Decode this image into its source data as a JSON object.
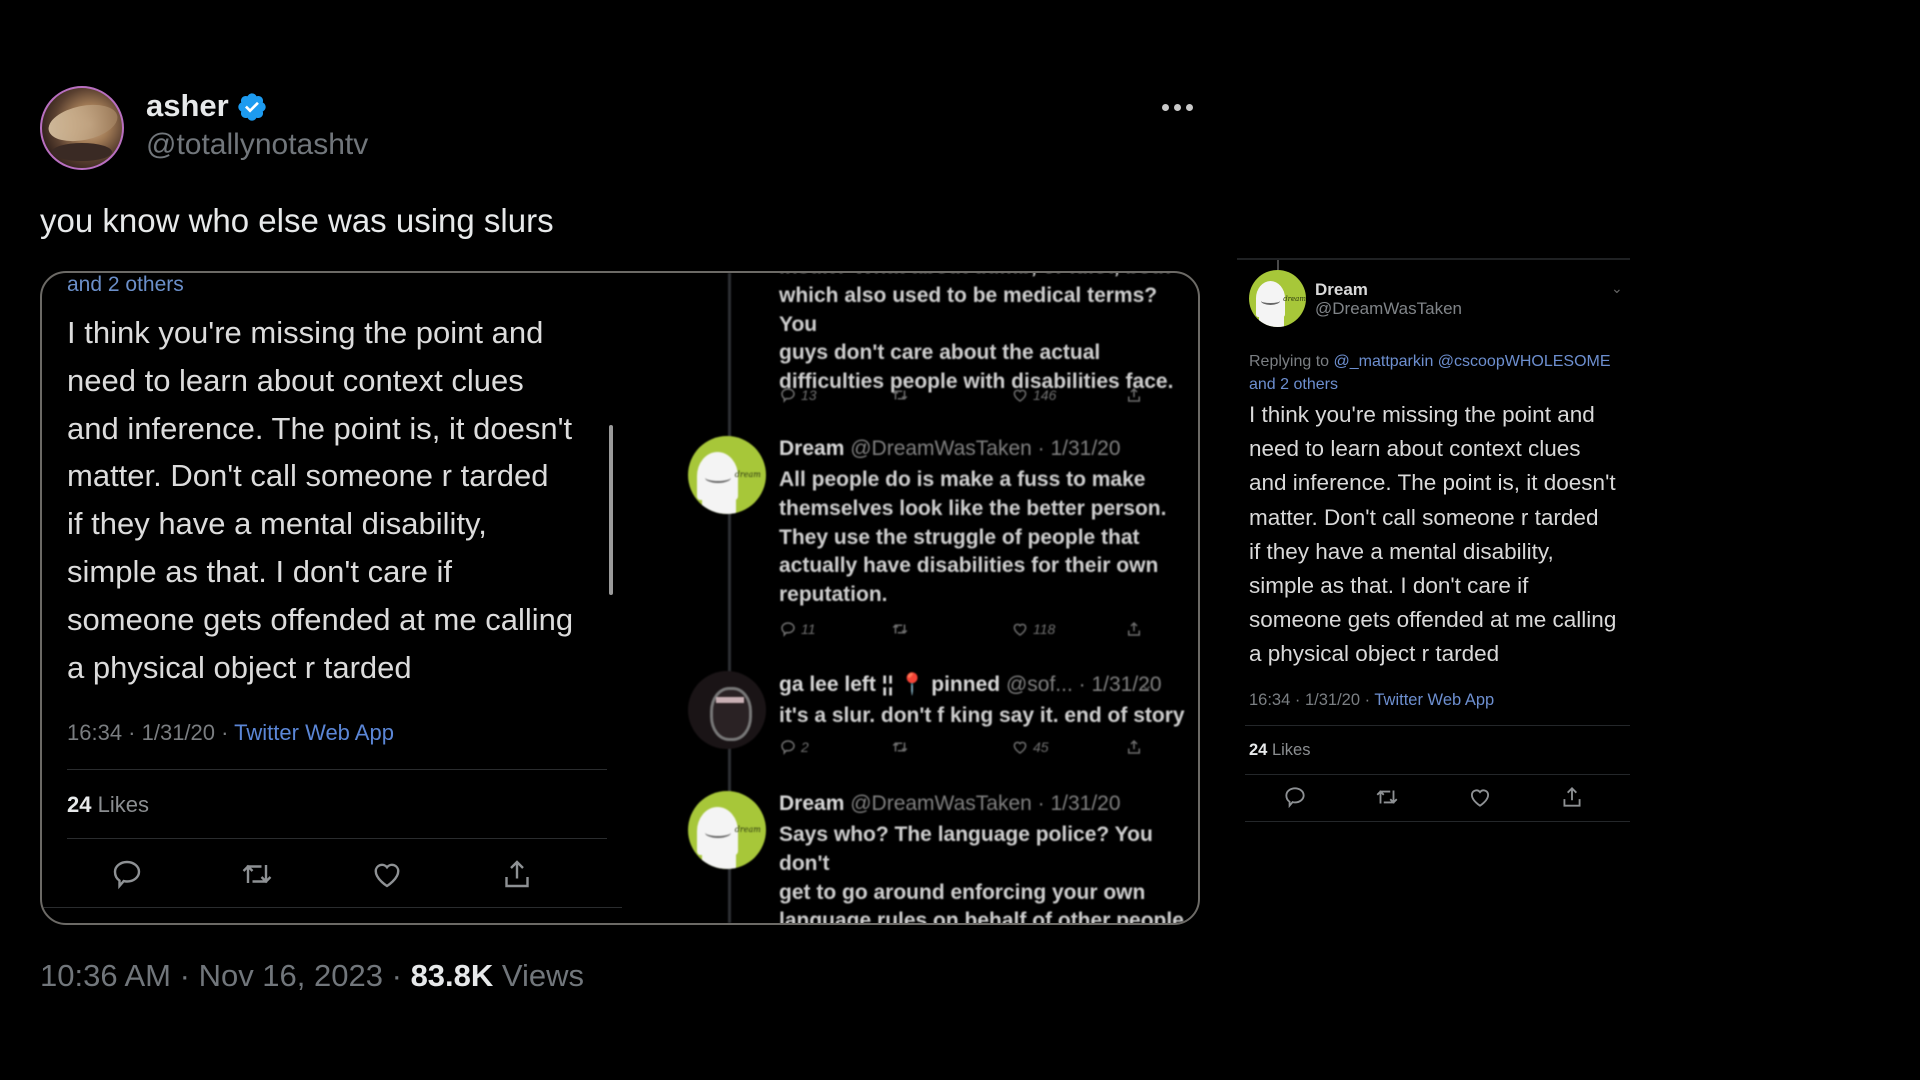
{
  "tweet": {
    "author": {
      "display_name": "asher",
      "handle": "@totallynotashtv",
      "verified": true,
      "verified_color": "#1d9bf0",
      "avatar_icon": "profile-photo"
    },
    "more_icon": "more-horizontal-icon",
    "text": "you know who else was using slurs",
    "timestamp": "10:36 AM",
    "separator": "·",
    "date": "Nov 16, 2023",
    "views_count": "83.8K",
    "views_label": "Views"
  },
  "media_screenshot": {
    "left_panel": {
      "others": "and 2 others",
      "body": "I think you're missing the point and\nneed to learn about context clues\nand inference. The point is, it doesn't\nmatter. Don't call someone r  tarded\nif they have a mental disability,\nsimple as that. I don't care if\nsomeone gets offended at me calling\na physical object r  tarded",
      "time": "16:34 · 1/31/20 · ",
      "source": "Twitter Web App",
      "likes_count": "24",
      "likes_label": "Likes",
      "actions": [
        "reply-icon",
        "retweet-icon",
        "like-icon",
        "share-icon"
      ]
    },
    "thread": [
      {
        "name": "",
        "handle_date": "",
        "text": "insult? What about dumb, or idiot, both of\nwhich also used to be medical terms? You\nguys don't care about the actual\ndifficulties people with disabilities face.",
        "replies": "13",
        "likes": "146"
      },
      {
        "name": "Dream",
        "handle_date": "@DreamWasTaken · 1/31/20",
        "text": "All people do is make a fuss to make\nthemselves look like the better person.\nThey use the struggle of people that\nactually have disabilities for their own\nreputation.",
        "replies": "11",
        "likes": "118"
      },
      {
        "name": "ga lee left ¦¦ 📍 pinned",
        "handle_date": "@sof... · 1/31/20",
        "text": "it's a slur. don't f     king say it. end of story",
        "replies": "2",
        "likes": "45"
      },
      {
        "name": "Dream",
        "handle_date": "@DreamWasTaken · 1/31/20",
        "text": "Says who? The language police? You don't\nget to go around enforcing your own\nlanguage rules on behalf of other people.\nIt's a descriptive word, and has been used",
        "replies": "",
        "likes": ""
      }
    ]
  },
  "quoted_panel": {
    "name": "Dream",
    "handle": "@DreamWasTaken",
    "avatar_label": "dream",
    "avatar_color": "#a7c739",
    "replying_prefix": "Replying to ",
    "replying_to": "@_mattparkin @cscoopWHOLESOME",
    "replying_others": "and 2 others",
    "body": "I think you're missing the point and\nneed to learn about context clues\nand inference. The point is, it doesn't\nmatter. Don't call someone r  tarded\nif they have a mental disability,\nsimple as that. I don't care if\nsomeone gets offended at me calling\na physical object r  tarded",
    "time": "16:34 · 1/31/20 · ",
    "source": "Twitter Web App",
    "likes_count": "24",
    "likes_label": "Likes",
    "actions": [
      "reply-icon",
      "retweet-icon",
      "like-icon",
      "share-icon"
    ]
  }
}
